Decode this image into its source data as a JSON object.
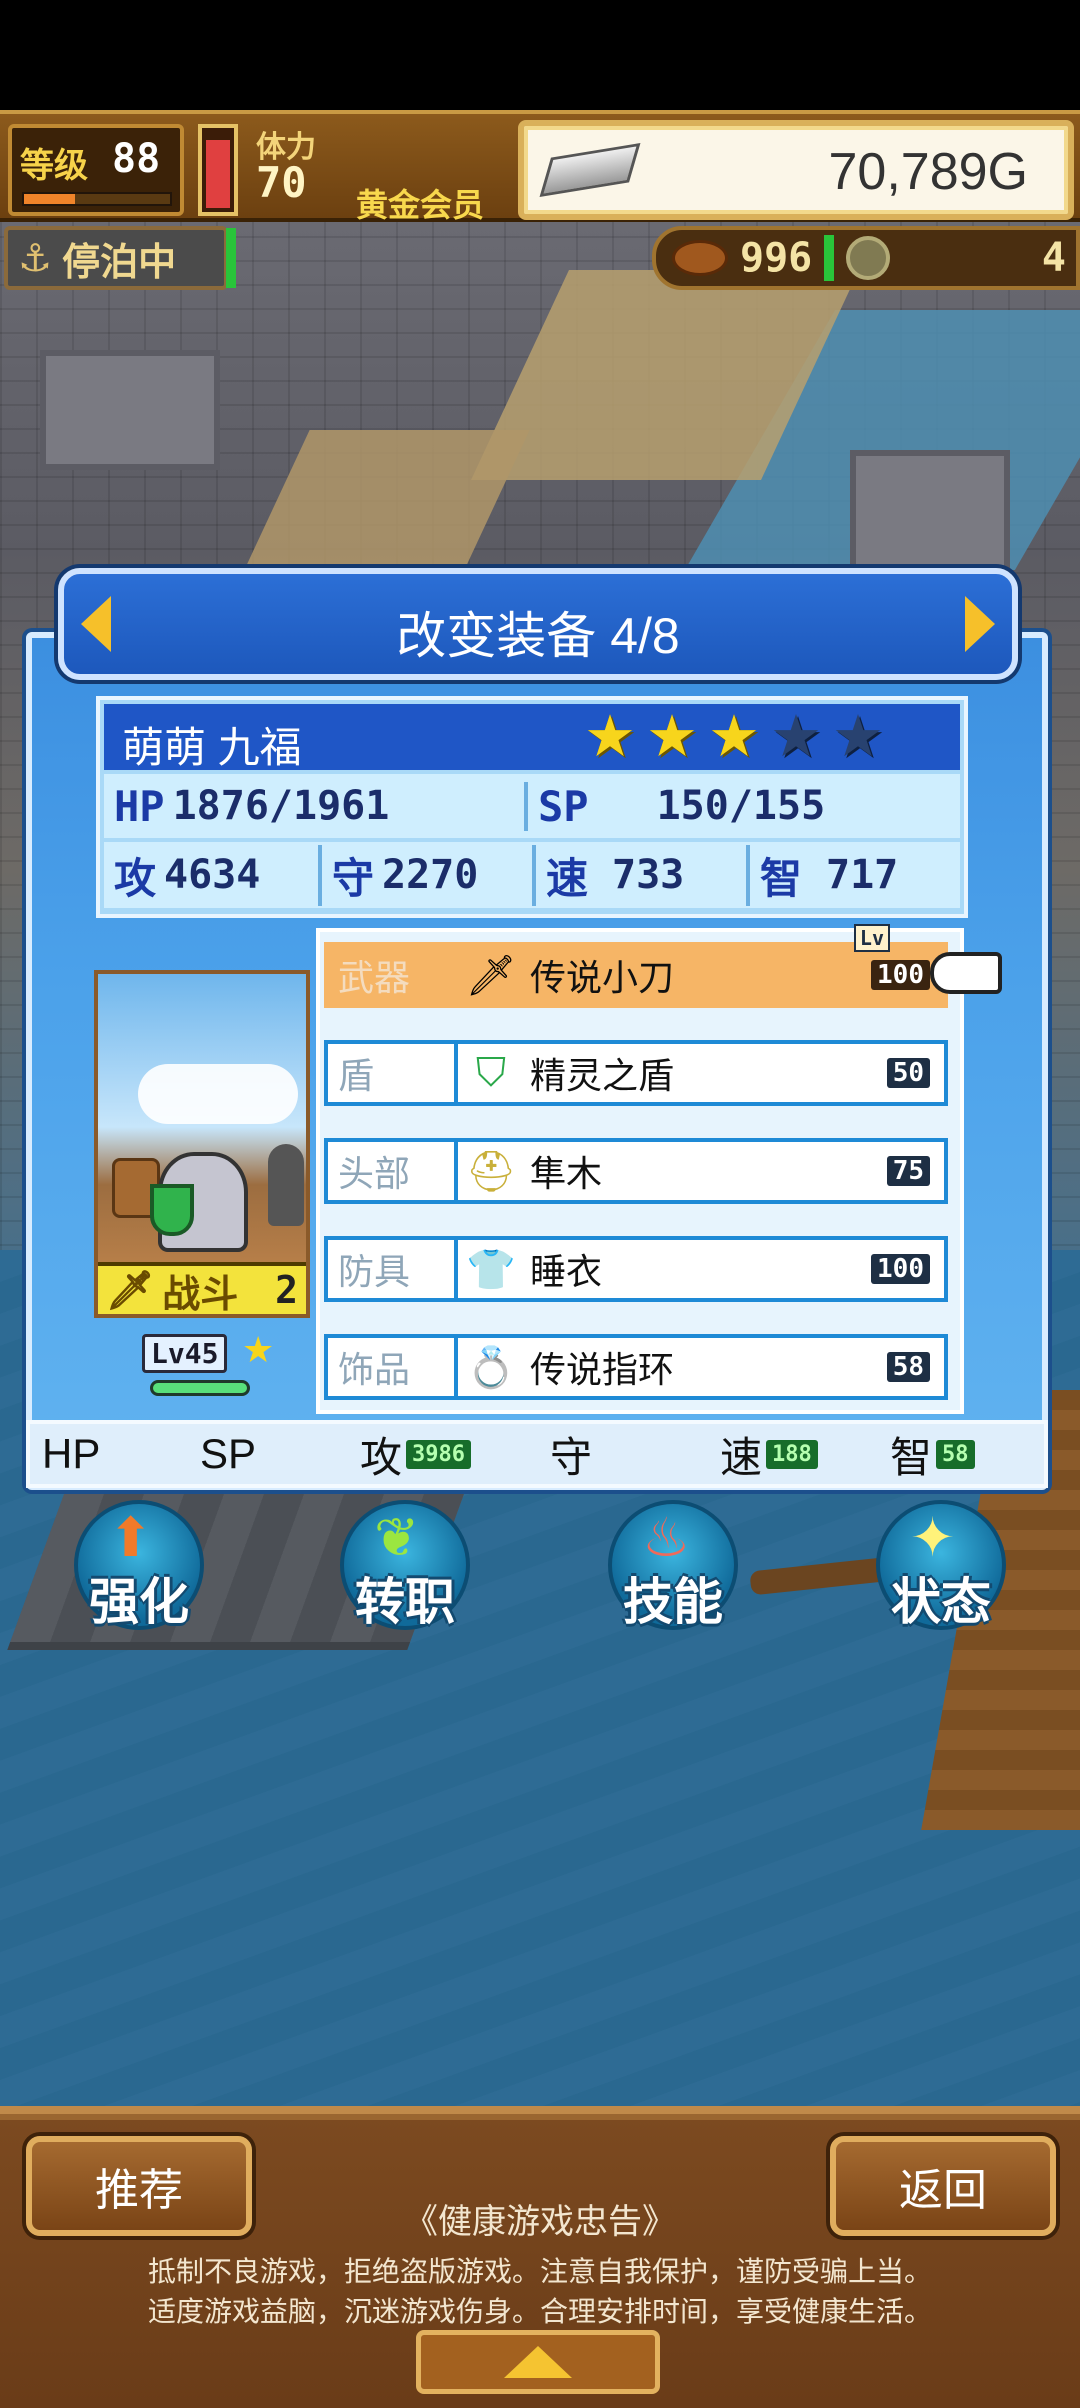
{
  "hud": {
    "level_label": "等级",
    "level_value": "88",
    "level_progress": 0.35,
    "stamina_label": "体力",
    "stamina_value": "70",
    "stamina_fill": 0.9,
    "membership": "黄金会员",
    "gold": "70,789G",
    "dock_status": "停泊中",
    "food_count": "996",
    "coin_count": "4"
  },
  "panel": {
    "title": "改变装备 4/8",
    "character": {
      "name": "萌萌 九福",
      "stars_total": 5,
      "stars_filled": 3,
      "hp_label": "HP",
      "hp": "1876/1961",
      "sp_label": "SP",
      "sp": "150/155",
      "atk_label": "攻",
      "atk": "4634",
      "def_label": "守",
      "def": "2270",
      "spd_label": "速",
      "spd": "733",
      "int_label": "智",
      "int": "717",
      "battle_label": "战斗",
      "battle_num": "2",
      "level": "Lv45"
    },
    "lv_tag": "Lv",
    "equipment": [
      {
        "slot": "武器",
        "name": "传说小刀",
        "level": "100",
        "icon": "knife-icon"
      },
      {
        "slot": "盾",
        "name": "精灵之盾",
        "level": "50",
        "icon": "shield-icon"
      },
      {
        "slot": "头部",
        "name": "隼木",
        "level": "75",
        "icon": "helmet-icon"
      },
      {
        "slot": "防具",
        "name": "睡衣",
        "level": "100",
        "icon": "armor-icon"
      },
      {
        "slot": "饰品",
        "name": "传说指环",
        "level": "58",
        "icon": "ring-icon"
      }
    ],
    "bonus": {
      "hp_label": "HP",
      "sp_label": "SP",
      "atk_label": "攻",
      "atk_bonus": "3986",
      "def_label": "守",
      "spd_label": "速",
      "spd_bonus": "188",
      "int_label": "智",
      "int_bonus": "58"
    }
  },
  "actions": {
    "enhance": "强化",
    "change_job": "转职",
    "skills": "技能",
    "status": "状态"
  },
  "footer": {
    "recommend": "推荐",
    "back": "返回",
    "advice_title": "《健康游戏忠告》",
    "advice_line1": "抵制不良游戏，拒绝盗版游戏。注意自我保护，谨防受骗上当。",
    "advice_line2": "适度游戏益脑，沉迷游戏伤身。合理安排时间，享受健康生活。"
  }
}
